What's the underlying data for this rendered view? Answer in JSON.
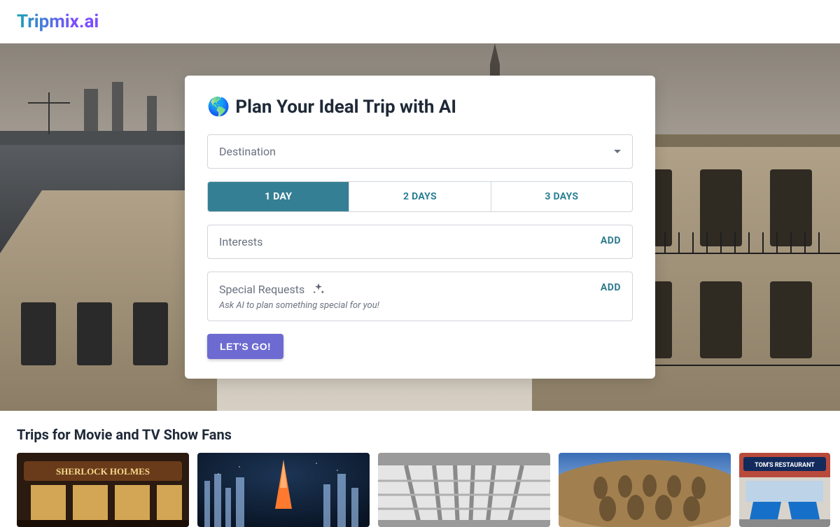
{
  "header": {
    "brand": "Tripmix.ai"
  },
  "card": {
    "emoji": "🌎",
    "title": "Plan Your Ideal Trip with AI",
    "destination_placeholder": "Destination",
    "day_tabs": [
      "1 DAY",
      "2 DAYS",
      "3 DAYS"
    ],
    "active_day_index": 0,
    "interests_label": "Interests",
    "interests_add": "ADD",
    "special_label": "Special Requests",
    "special_sub": "Ask AI to plan something special for you!",
    "special_add": "ADD",
    "go_button": "LET'S GO!"
  },
  "section": {
    "title": "Trips for Movie and TV Show Fans",
    "thumbs": [
      {
        "name": "sherlock-london"
      },
      {
        "name": "tokyo-night"
      },
      {
        "name": "paris-bridge"
      },
      {
        "name": "rome-colosseum"
      },
      {
        "name": "nyc-diner"
      }
    ]
  }
}
